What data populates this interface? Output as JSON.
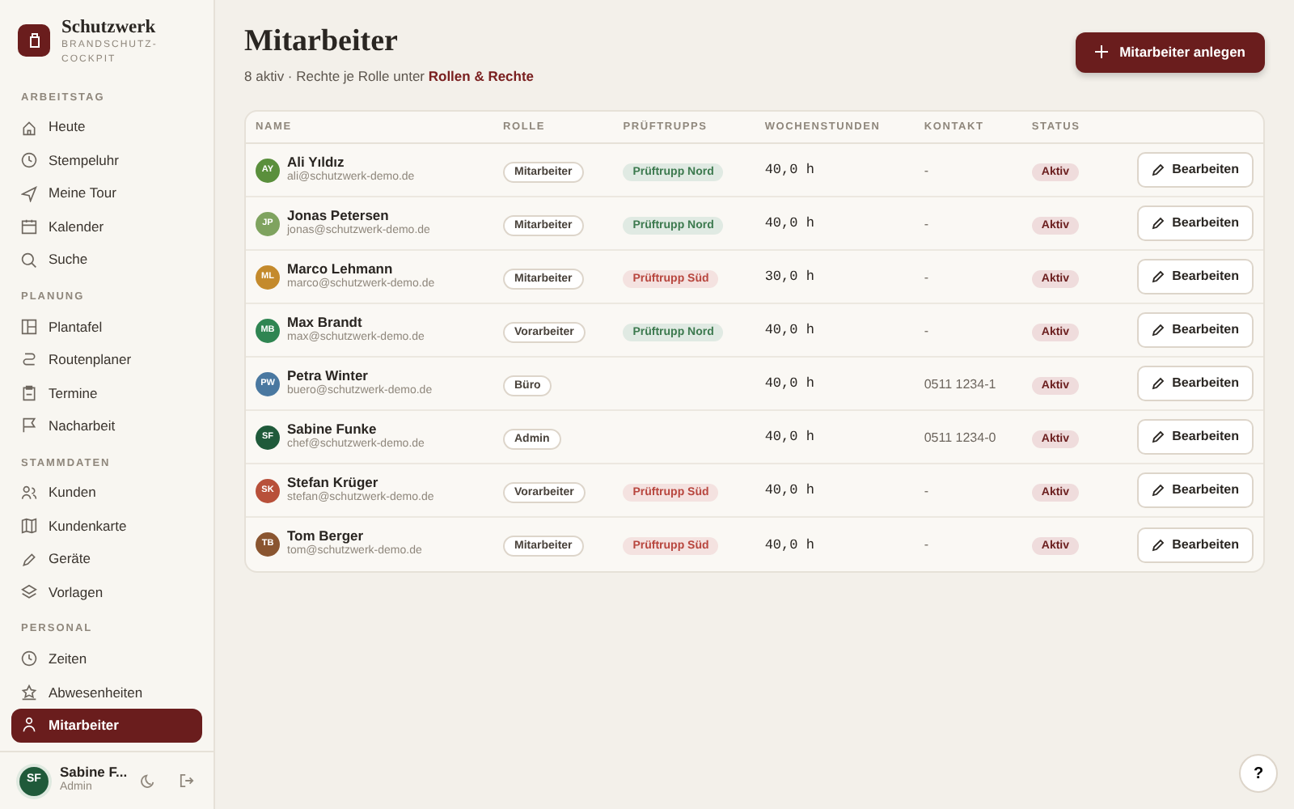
{
  "brand": {
    "name": "Schutzwerk",
    "tagline": "BRANDSCHUTZ-\nCOCKPIT"
  },
  "sidebar": {
    "sections": [
      {
        "title": "ARBEITSTAG",
        "items": [
          {
            "label": "Heute",
            "selected": false
          },
          {
            "label": "Stempeluhr",
            "selected": false
          },
          {
            "label": "Meine Tour",
            "selected": false
          },
          {
            "label": "Kalender",
            "selected": false
          },
          {
            "label": "Suche",
            "selected": false
          }
        ]
      },
      {
        "title": "PLANUNG",
        "items": [
          {
            "label": "Plantafel",
            "selected": false
          },
          {
            "label": "Routenplaner",
            "selected": false
          },
          {
            "label": "Termine",
            "selected": false
          },
          {
            "label": "Nacharbeit",
            "selected": false
          }
        ]
      },
      {
        "title": "STAMMDATEN",
        "items": [
          {
            "label": "Kunden",
            "selected": false
          },
          {
            "label": "Kundenkarte",
            "selected": false
          },
          {
            "label": "Geräte",
            "selected": false
          },
          {
            "label": "Vorlagen",
            "selected": false
          }
        ]
      },
      {
        "title": "PERSONAL",
        "items": [
          {
            "label": "Zeiten",
            "selected": false
          },
          {
            "label": "Abwesenheiten",
            "selected": false
          },
          {
            "label": "Mitarbeiter",
            "selected": true
          }
        ]
      }
    ]
  },
  "user": {
    "initials": "SF",
    "name": "Sabine F...",
    "role": "Admin"
  },
  "page": {
    "title": "Mitarbeiter",
    "subtitle": "8 aktiv · Rechte je Rolle unter ",
    "subtitle_link": "Rollen & Rechte",
    "add_button": "Mitarbeiter anlegen"
  },
  "table": {
    "columns": [
      "NAME",
      "ROLLE",
      "PRÜFTRUPPS",
      "WOCHENSTUNDEN",
      "KONTAKT",
      "STATUS"
    ],
    "rows": [
      {
        "initials": "AY",
        "color": "#5a8f3c",
        "name": "Ali Yıldız",
        "email": "ali@schutzwerk-demo.de",
        "role": "Mitarbeiter",
        "team": {
          "label": "Prüftrupp Nord",
          "color": "#3d7a4f"
        },
        "hours": "40,0 h",
        "contact": "-",
        "status": "Aktiv",
        "action": "Bearbeiten"
      },
      {
        "initials": "JP",
        "color": "#7fa35f",
        "name": "Jonas Petersen",
        "email": "jonas@schutzwerk-demo.de",
        "role": "Mitarbeiter",
        "team": {
          "label": "Prüftrupp Nord",
          "color": "#3d7a4f"
        },
        "hours": "40,0 h",
        "contact": "-",
        "status": "Aktiv",
        "action": "Bearbeiten"
      },
      {
        "initials": "ML",
        "color": "#c48a2c",
        "name": "Marco Lehmann",
        "email": "marco@schutzwerk-demo.de",
        "role": "Mitarbeiter",
        "team": {
          "label": "Prüftrupp Süd",
          "color": "#b8473f"
        },
        "hours": "30,0 h",
        "contact": "-",
        "status": "Aktiv",
        "action": "Bearbeiten"
      },
      {
        "initials": "MB",
        "color": "#2f8552",
        "name": "Max Brandt",
        "email": "max@schutzwerk-demo.de",
        "role": "Vorarbeiter",
        "team": {
          "label": "Prüftrupp Nord",
          "color": "#3d7a4f"
        },
        "hours": "40,0 h",
        "contact": "-",
        "status": "Aktiv",
        "action": "Bearbeiten"
      },
      {
        "initials": "PW",
        "color": "#4a78a0",
        "name": "Petra Winter",
        "email": "buero@schutzwerk-demo.de",
        "role": "Büro",
        "hours": "40,0 h",
        "contact": "0511 1234-1",
        "status": "Aktiv",
        "action": "Bearbeiten"
      },
      {
        "initials": "SF",
        "color": "#1f5a3a",
        "name": "Sabine Funke",
        "email": "chef@schutzwerk-demo.de",
        "role": "Admin",
        "hours": "40,0 h",
        "contact": "0511 1234-0",
        "status": "Aktiv",
        "action": "Bearbeiten"
      },
      {
        "initials": "SK",
        "color": "#b8503a",
        "name": "Stefan Krüger",
        "email": "stefan@schutzwerk-demo.de",
        "role": "Vorarbeiter",
        "team": {
          "label": "Prüftrupp Süd",
          "color": "#b8473f"
        },
        "hours": "40,0 h",
        "contact": "-",
        "status": "Aktiv",
        "action": "Bearbeiten"
      },
      {
        "initials": "TB",
        "color": "#8a5530",
        "name": "Tom Berger",
        "email": "tom@schutzwerk-demo.de",
        "role": "Mitarbeiter",
        "team": {
          "label": "Prüftrupp Süd",
          "color": "#b8473f"
        },
        "hours": "40,0 h",
        "contact": "-",
        "status": "Aktiv",
        "action": "Bearbeiten"
      }
    ]
  },
  "help_button": "?"
}
